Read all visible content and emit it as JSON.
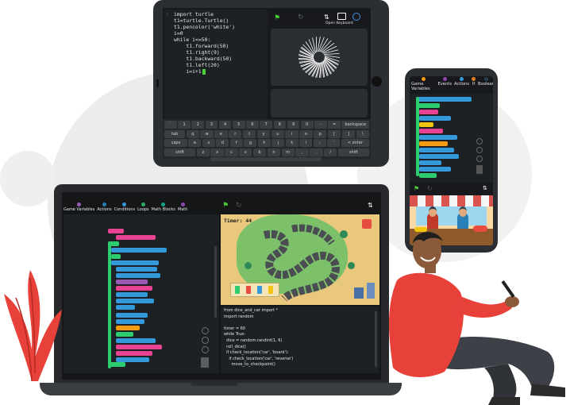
{
  "tablet": {
    "code_lines": [
      "import turtle",
      "t1=turtle.Turtle()",
      "t1.pencolor('white')",
      "i=0",
      "while i<=50:",
      "    t1.forward(50)",
      "    t1.right(9)",
      "    t1.backward(50)",
      "    t1.left(20)",
      "    i=i+1"
    ],
    "line_marker": ":",
    "open_keyboard_label": "Open Keyboard",
    "keyboard_rows": [
      [
        "`",
        "1",
        "2",
        "3",
        "4",
        "5",
        "6",
        "7",
        "8",
        "9",
        "0",
        "-",
        "=",
        "backspace"
      ],
      [
        "tab",
        "q",
        "w",
        "e",
        "r",
        "t",
        "y",
        "u",
        "i",
        "o",
        "p",
        "[",
        "]",
        "\\"
      ],
      [
        "caps",
        "a",
        "s",
        "d",
        "f",
        "g",
        "h",
        "j",
        "k",
        "l",
        ";",
        "'",
        "< enter"
      ],
      [
        "shift",
        "z",
        "x",
        "c",
        "v",
        "b",
        "n",
        "m",
        ",",
        ".",
        "/",
        "shift"
      ]
    ]
  },
  "phone": {
    "tabs": [
      "Game Variables",
      "Events",
      "Actions",
      "If",
      "Boolean"
    ],
    "tab_colors": [
      "#f39c12",
      "#8e44ad",
      "#3498db",
      "#e67e22",
      "#2c3e50"
    ]
  },
  "laptop": {
    "tabs": [
      "Game Variables",
      "Actions",
      "Conditions",
      "Loops",
      "Math Blocks",
      "Math"
    ],
    "tab_colors": [
      "#9b59b6",
      "#2980b9",
      "#3498db",
      "#27ae60",
      "#16a085",
      "#8e44ad"
    ],
    "timer_text": "Timer: 44",
    "code_lines": [
      "from dice_and_car import *",
      "import random",
      "",
      "timer = 60",
      "while True:",
      "  dice = random.randint(1, 6)",
      "  roll_dice()",
      "  if check_location('car', 'board'):",
      "    if check_location('car', 'reverse')",
      "      move_to_checkpoint()"
    ]
  },
  "colors": {
    "accent_red": "#e8413a",
    "dark_panel": "#1e2023",
    "green_flag": "#4cd137"
  }
}
